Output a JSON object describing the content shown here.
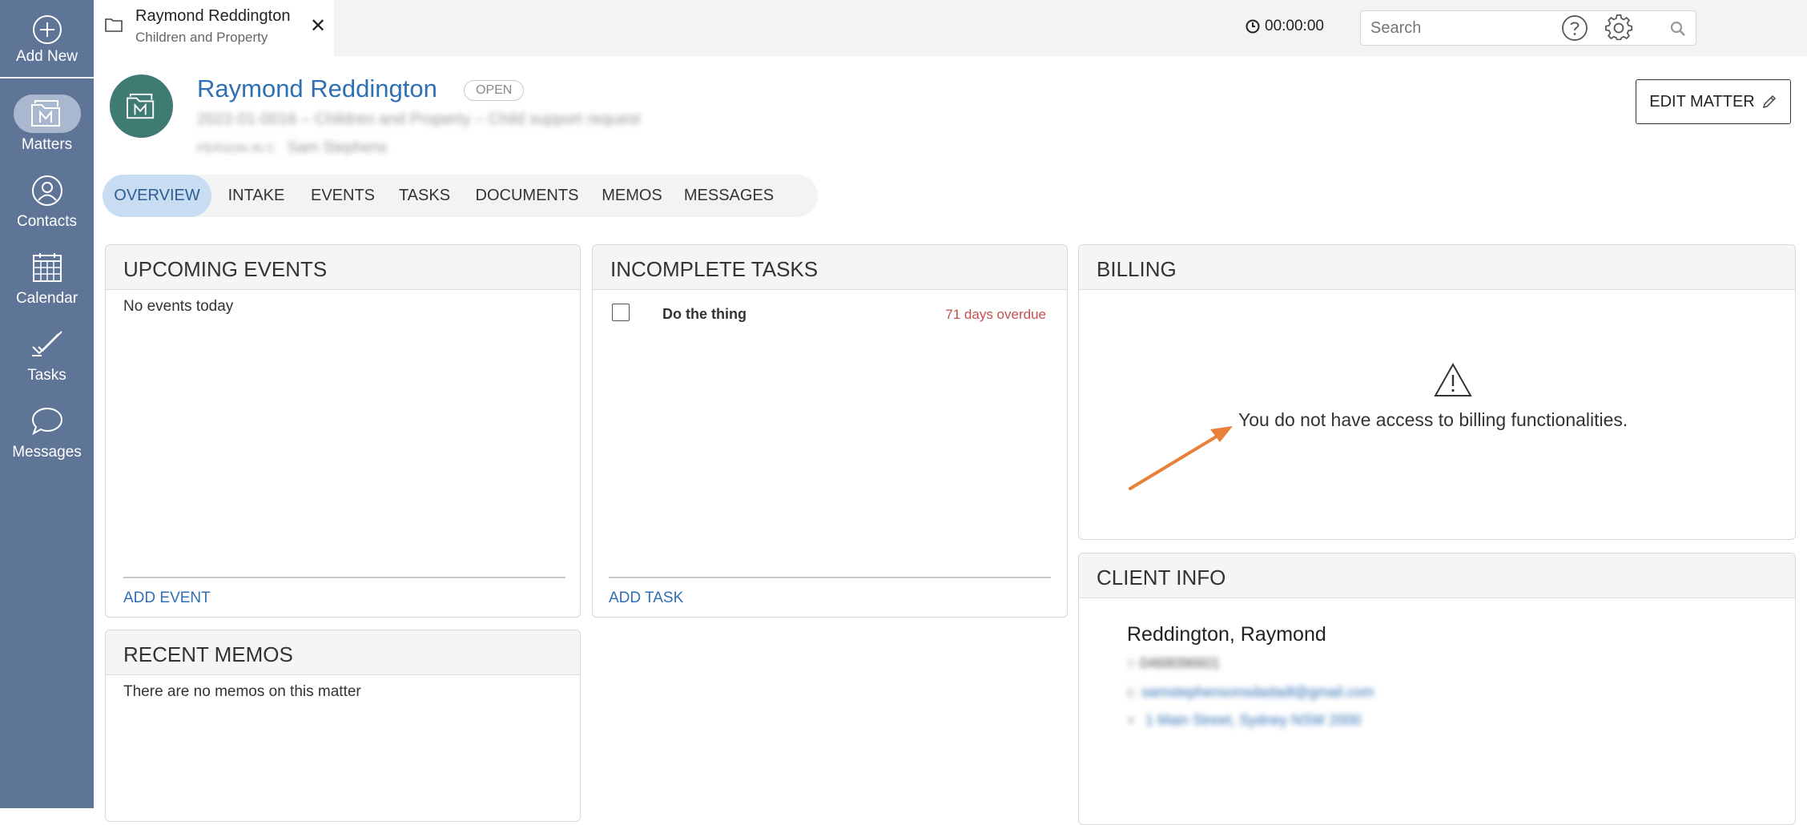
{
  "sidebar": {
    "items": [
      {
        "label": "Add New",
        "icon": "plus-circle-icon"
      },
      {
        "label": "Matters",
        "icon": "matters-icon",
        "active": true
      },
      {
        "label": "Contacts",
        "icon": "contact-icon"
      },
      {
        "label": "Calendar",
        "icon": "calendar-icon"
      },
      {
        "label": "Tasks",
        "icon": "tasks-icon"
      },
      {
        "label": "Messages",
        "icon": "message-icon"
      }
    ]
  },
  "topbar": {
    "tab_title": "Raymond Reddington",
    "tab_subtitle": "Children and Property",
    "tab_close": "✕",
    "timer": "00:00:00",
    "search_placeholder": "Search"
  },
  "matter": {
    "name": "Raymond Reddington",
    "status": "OPEN",
    "meta_line1": "2022-01-0016 – Children and Property – Child support request",
    "meta_line2_label": "PERSON IN C",
    "meta_line2_value": "Sam Stephens",
    "edit_label": "EDIT MATTER"
  },
  "tabs": [
    {
      "label": "OVERVIEW",
      "active": true
    },
    {
      "label": "INTAKE"
    },
    {
      "label": "EVENTS"
    },
    {
      "label": "TASKS"
    },
    {
      "label": "DOCUMENTS"
    },
    {
      "label": "MEMOS"
    },
    {
      "label": "MESSAGES"
    }
  ],
  "upcoming_events": {
    "title": "UPCOMING EVENTS",
    "empty": "No events today",
    "add_label": "ADD EVENT"
  },
  "incomplete_tasks": {
    "title": "INCOMPLETE TASKS",
    "tasks": [
      {
        "name": "Do the thing",
        "status": "71 days overdue"
      }
    ],
    "add_label": "ADD TASK"
  },
  "recent_memos": {
    "title": "RECENT MEMOS",
    "empty": "There are no memos on this matter"
  },
  "billing": {
    "title": "BILLING",
    "message": "You do not have access to billing functionalities."
  },
  "client_info": {
    "title": "CLIENT INFO",
    "name": "Reddington, Raymond",
    "phone_prefix": "T:",
    "phone": "0468096601",
    "email_prefix": "E:",
    "email": "samstephensonsdadadl@gmail.com",
    "address": "1 Main Street, Sydney NSW 2000"
  },
  "colors": {
    "sidebar": "#5f7598",
    "accent_link": "#2f6fb5",
    "avatar": "#3f7a73",
    "overdue": "#c0504d",
    "annotation_arrow": "#e8803a",
    "active_tab": "#c8dcf2"
  }
}
